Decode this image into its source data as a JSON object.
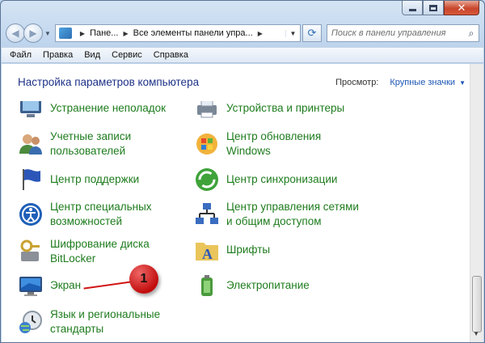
{
  "address_bar": {
    "crumbs": [
      "Пане...",
      "Все элементы панели упра..."
    ]
  },
  "search": {
    "placeholder": "Поиск в панели управления"
  },
  "menu": [
    "Файл",
    "Правка",
    "Вид",
    "Сервис",
    "Справка"
  ],
  "header": {
    "title": "Настройка параметров компьютера",
    "view_label": "Просмотр:",
    "view_value": "Крупные значки"
  },
  "items": {
    "troubleshooting": "Устранение неполадок",
    "devices_printers": "Устройства и принтеры",
    "user_accounts": "Учетные записи\nпользователей",
    "windows_update": "Центр обновления\nWindows",
    "action_center": "Центр поддержки",
    "sync_center": "Центр синхронизации",
    "ease_of_access": "Центр специальных\nвозможностей",
    "network_center": "Центр управления сетями\nи общим доступом",
    "bitlocker": "Шифрование диска\nBitLocker",
    "fonts": "Шрифты",
    "display": "Экран",
    "power": "Электропитание",
    "region_language": "Язык и региональные\nстандарты"
  },
  "callout": {
    "number": "1"
  },
  "colors": {
    "link_green": "#1e7c1e",
    "title_blue": "#1e3287",
    "callout_red": "#c10d0d"
  }
}
